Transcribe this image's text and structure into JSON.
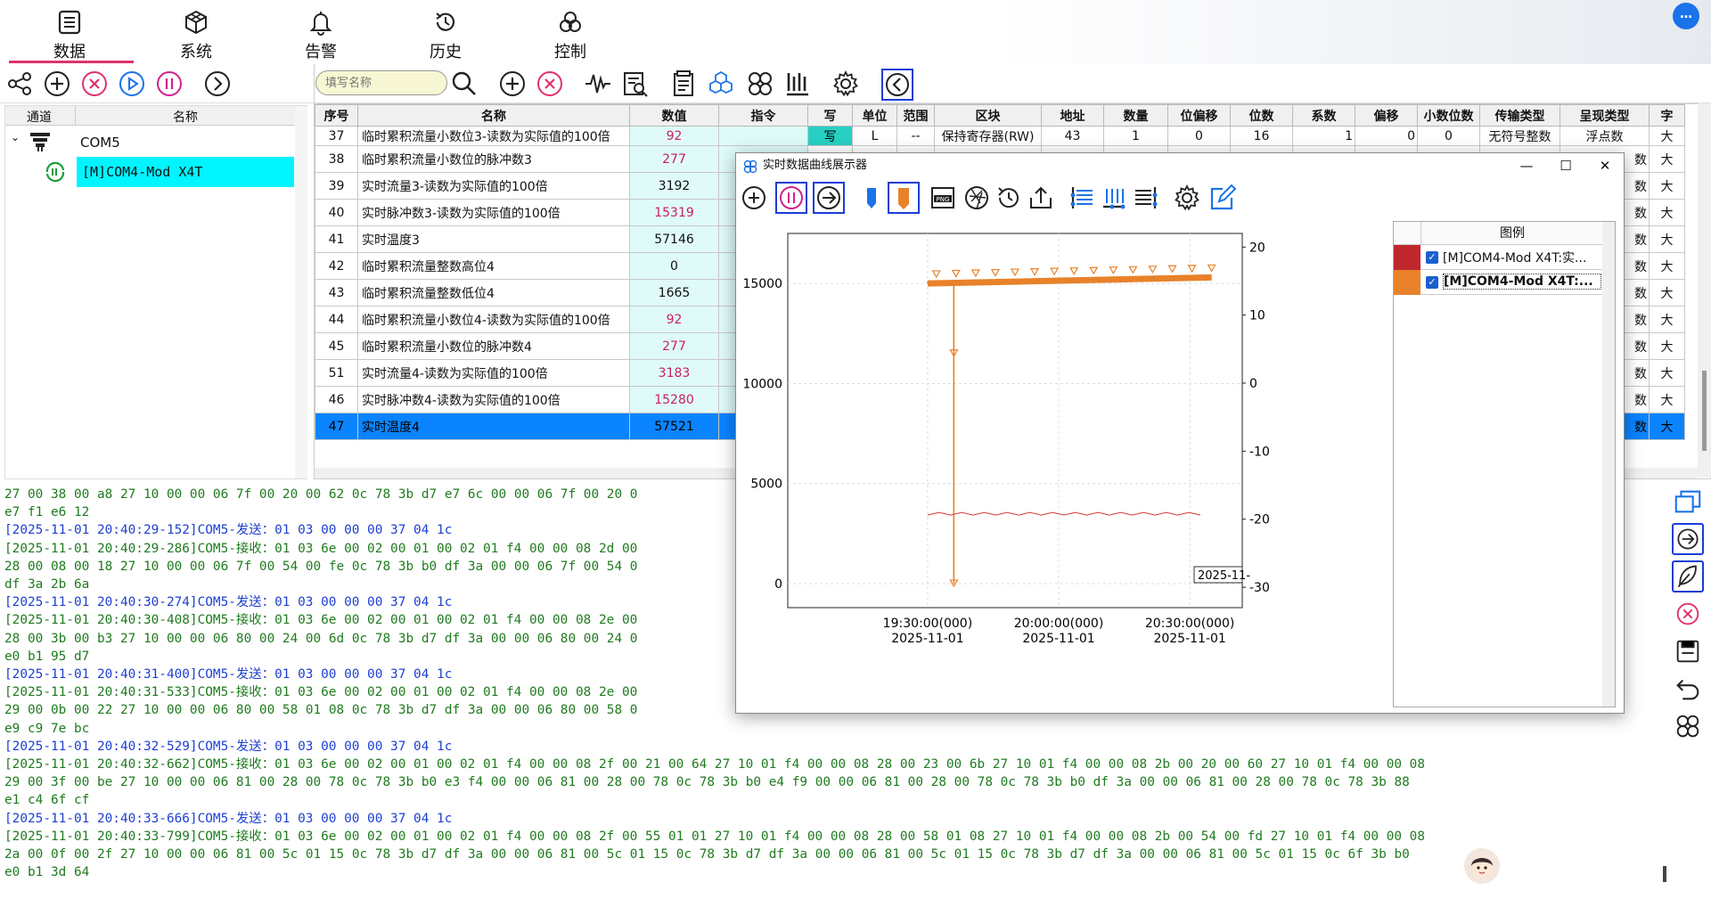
{
  "nav": {
    "tabs": [
      {
        "label": "数据",
        "icon": "data-icon"
      },
      {
        "label": "系统",
        "icon": "cube-icon"
      },
      {
        "label": "告警",
        "icon": "bell-icon"
      },
      {
        "label": "历史",
        "icon": "history-icon"
      },
      {
        "label": "控制",
        "icon": "control-icon"
      }
    ],
    "active": "数据",
    "chat": "…"
  },
  "search": {
    "placeholder": "填写名称"
  },
  "tree": {
    "headers": [
      "通道",
      "名称"
    ],
    "port": "COM5",
    "device": "[M]COM4-Mod X4T"
  },
  "grid": {
    "headers": [
      "序号",
      "名称",
      "数值",
      "指令",
      "写",
      "单位",
      "范围",
      "区块",
      "地址",
      "数量",
      "位偏移",
      "位数",
      "系数",
      "偏移",
      "小数位数",
      "传输类型",
      "呈现类型",
      "字"
    ],
    "first_row": {
      "seq": "37",
      "name": "临时累积流量小数位3-读数为实际值的100倍",
      "value": "92",
      "cmd": "",
      "write": "写",
      "unit": "L",
      "range": "--",
      "block": "保持寄存器(RW)",
      "addr": "43",
      "count": "1",
      "bitoff": "0",
      "bits": "16",
      "coef": "1",
      "offset": "0",
      "dec": "0",
      "trans": "无符号整数",
      "disp": "浮点数",
      "last": "大"
    },
    "rows": [
      {
        "seq": "38",
        "name": "临时累积流量小数位的脉冲数3",
        "value": "277",
        "red": true,
        "disp": "数",
        "last": "大"
      },
      {
        "seq": "39",
        "name": "实时流量3-读数为实际值的100倍",
        "value": "3192",
        "red": false,
        "disp": "数",
        "last": "大"
      },
      {
        "seq": "40",
        "name": "实时脉冲数3-读数为实际值的100倍",
        "value": "15319",
        "red": true,
        "disp": "数",
        "last": "大"
      },
      {
        "seq": "41",
        "name": "实时温度3",
        "value": "57146",
        "red": false,
        "disp": "数",
        "last": "大"
      },
      {
        "seq": "42",
        "name": "临时累积流量整数高位4",
        "value": "0",
        "red": false,
        "disp": "数",
        "last": "大"
      },
      {
        "seq": "43",
        "name": "临时累积流量整数低位4",
        "value": "1665",
        "red": false,
        "disp": "数",
        "last": "大"
      },
      {
        "seq": "44",
        "name": "临时累积流量小数位4-读数为实际值的100倍",
        "value": "92",
        "red": true,
        "disp": "数",
        "last": "大"
      },
      {
        "seq": "45",
        "name": "临时累积流量小数位的脉冲数4",
        "value": "277",
        "red": true,
        "disp": "数",
        "last": "大"
      },
      {
        "seq": "51",
        "name": "实时流量4-读数为实际值的100倍",
        "value": "3183",
        "red": true,
        "disp": "数",
        "last": "大"
      },
      {
        "seq": "46",
        "name": "实时脉冲数4-读数为实际值的100倍",
        "value": "15280",
        "red": true,
        "disp": "数",
        "last": "大"
      },
      {
        "seq": "47",
        "name": "实时温度4",
        "value": "57521",
        "red": false,
        "disp": "数",
        "last": "大",
        "selected": true
      }
    ]
  },
  "log": [
    {
      "t": "r",
      "text": "27 00 38 00 a8 27 10 00 00 06 7f 00 20 00 62 0c 78 3b d7 e7 6c 00 00 06 7f 00 20 0"
    },
    {
      "t": "r",
      "text": "e7 f1 e6 12"
    },
    {
      "t": "s",
      "text": "[2025-11-01 20:40:29-152]COM5-发送：01 03 00 00 00 37 04 1c"
    },
    {
      "t": "r",
      "text": "[2025-11-01 20:40:29-286]COM5-接收：01 03 6e 00 02 00 01 00 02 01 f4 00 00 08 2d 00"
    },
    {
      "t": "r",
      "text": "28 00 08 00 18 27 10 00 00 06 7f 00 54 00 fe 0c 78 3b b0 df 3a 00 00 06 7f 00 54 0"
    },
    {
      "t": "r",
      "text": "df 3a 2b 6a"
    },
    {
      "t": "s",
      "text": "[2025-11-01 20:40:30-274]COM5-发送：01 03 00 00 00 37 04 1c"
    },
    {
      "t": "r",
      "text": "[2025-11-01 20:40:30-408]COM5-接收：01 03 6e 00 02 00 01 00 02 01 f4 00 00 08 2e 00"
    },
    {
      "t": "r",
      "text": "28 00 3b 00 b3 27 10 00 00 06 80 00 24 00 6d 0c 78 3b d7 df 3a 00 00 06 80 00 24 0"
    },
    {
      "t": "r",
      "text": "e0 b1 95 d7"
    },
    {
      "t": "s",
      "text": "[2025-11-01 20:40:31-400]COM5-发送：01 03 00 00 00 37 04 1c"
    },
    {
      "t": "r",
      "text": "[2025-11-01 20:40:31-533]COM5-接收：01 03 6e 00 02 00 01 00 02 01 f4 00 00 08 2e 00"
    },
    {
      "t": "r",
      "text": "29 00 0b 00 22 27 10 00 00 06 80 00 58 01 08 0c 78 3b d7 df 3a 00 00 06 80 00 58 0"
    },
    {
      "t": "r",
      "text": "e9 c9 7e bc"
    },
    {
      "t": "s",
      "text": "[2025-11-01 20:40:32-529]COM5-发送：01 03 00 00 00 37 04 1c"
    },
    {
      "t": "r",
      "text": "[2025-11-01 20:40:32-662]COM5-接收：01 03 6e 00 02 00 01 00 02 01 f4 00 00 08 2f 00 21 00 64 27 10 01 f4 00 00 08 28 00 23 00 6b 27 10 01 f4 00 00 08 2b 00 20 00 60 27 10 01 f4 00 00 08"
    },
    {
      "t": "r",
      "text": "29 00 3f 00 be 27 10 00 00 06 81 00 28 00 78 0c 78 3b b0 e3 f4 00 00 06 81 00 28 00 78 0c 78 3b b0 e4 f9 00 00 06 81 00 28 00 78 0c 78 3b b0 df 3a 00 00 06 81 00 28 00 78 0c 78 3b 88"
    },
    {
      "t": "r",
      "text": "e1 c4 6f cf"
    },
    {
      "t": "s",
      "text": "[2025-11-01 20:40:33-666]COM5-发送：01 03 00 00 00 37 04 1c"
    },
    {
      "t": "r",
      "text": "[2025-11-01 20:40:33-799]COM5-接收：01 03 6e 00 02 00 01 00 02 01 f4 00 00 08 2f 00 55 01 01 27 10 01 f4 00 00 08 28 00 58 01 08 27 10 01 f4 00 00 08 2b 00 54 00 fd 27 10 01 f4 00 00 08"
    },
    {
      "t": "r",
      "text": "2a 00 0f 00 2f 27 10 00 00 06 81 00 5c 01 15 0c 78 3b d7 df 3a 00 00 06 81 00 5c 01 15 0c 78 3b d7 df 3a 00 00 06 81 00 5c 01 15 0c 78 3b d7 df 3a 00 00 06 81 00 5c 01 15 0c 6f 3b b0"
    },
    {
      "t": "r",
      "text": "e0 b1 3d 64"
    }
  ],
  "window": {
    "title": "实时数据曲线展示器",
    "controls": {
      "minimize": "—",
      "maximize": "☐",
      "close": "✕"
    },
    "legend_title": "图例",
    "legend": [
      {
        "text": "[M]COM4-Mod X4T:实...",
        "color": "#c0272d",
        "checked": true
      },
      {
        "text": "[M]COM4-Mod X4T:...",
        "color": "#e8822a",
        "checked": true,
        "bold": true
      }
    ]
  },
  "chart_data": {
    "type": "line",
    "x_ticks": [
      {
        "time": "19:30:00(000)",
        "date": "2025-11-01"
      },
      {
        "time": "20:00:00(000)",
        "date": "2025-11-01"
      },
      {
        "time": "20:30:00(000)",
        "date": "2025-11-01"
      }
    ],
    "y_left": {
      "ticks": [
        0,
        5000,
        10000,
        15000
      ],
      "lim": [
        -1200,
        17500
      ]
    },
    "y_right": {
      "ticks": [
        -30,
        -20,
        -10,
        0,
        10,
        20
      ],
      "lim": [
        -33,
        22
      ]
    },
    "hover_label": "2025-11-",
    "grid": true,
    "series": [
      {
        "axis": "left",
        "color": "#e8822a",
        "x_min": [
          0,
          0,
          6,
          6,
          6,
          6,
          6,
          65
        ],
        "y": [
          15000,
          15050,
          15100,
          11500,
          0,
          11500,
          15100,
          15300
        ]
      },
      {
        "axis": "right",
        "color": "#d23a3a",
        "x_min": [
          0,
          65
        ],
        "y": [
          -19.2,
          -19.2
        ]
      }
    ]
  }
}
